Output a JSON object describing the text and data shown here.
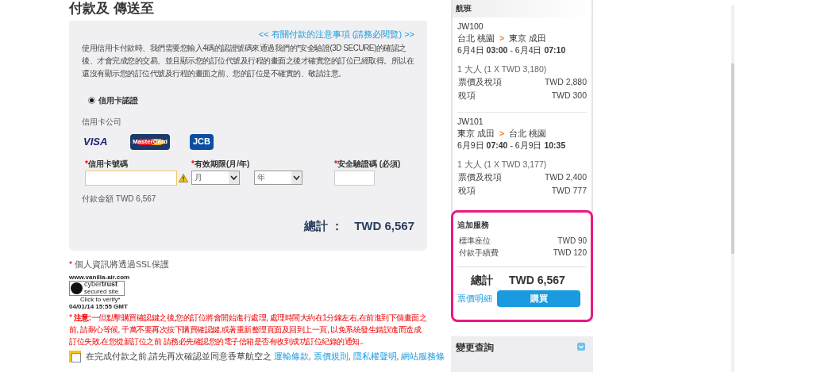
{
  "page_title": "付款及 傳送至",
  "payment": {
    "notice_link": "<< 有關付款的注意事項 (請務必閱覽) >>",
    "intro": "使用信用卡付款時、我們需要您輸入4碼的認證號碼來通過我們的*安全驗證(3D SECURE)的確認之後、才會完成您的交易、並且顯示您的訂位代號及行程的畫面之後才確實您的訂位已經取得。所以在還沒有顯示您的訂位代號及行程的畫面之前、您的訂位是不確實的、敬請注意。",
    "methods": [
      {
        "label": "信用卡認證",
        "selected": true
      }
    ],
    "card_company_label": "信用卡公司",
    "cards": [
      {
        "kind": "visa",
        "label": "VISA"
      },
      {
        "kind": "mastercard",
        "label": "MasterCard"
      },
      {
        "kind": "jcb",
        "label": "JCB"
      }
    ],
    "fields": [
      {
        "kind": "text",
        "mark": "*",
        "label": "信用卡號碼",
        "warning": true
      },
      {
        "kind": "expiry",
        "mark": "*",
        "label": "有效期限(月/年)",
        "selects": [
          "月",
          "年"
        ]
      },
      {
        "kind": "cvv",
        "mark": "*",
        "label": "安全驗證碼 (必須)"
      }
    ],
    "amount": "付款金額 TWD 6,567",
    "total_label": "總計 ：",
    "total_value": "TWD 6,567"
  },
  "ssl": {
    "mark": "*",
    "text": "個人資訊將透過SSL保護"
  },
  "seal": {
    "site": "www.vanilla-air.com",
    "brand_light": "cyber",
    "brand_bold": "trust",
    "sub": "secured site",
    "verify": "Click to verify*",
    "date": "04/01/14 15:55 GMT"
  },
  "caution": "* **注意:**一但點擊購買確認鍵之後,您的訂位將會開始進行處理, 處理時間大約在1分鐘左右,在前進到下個畫面之前, 請耐心等候, 千萬不要再次按下購買確認鍵,或著重新整理頁面及回到上一頁, 以免系統發生錯誤進而造成訂位失敗.在您從新訂位之前 請務必先確認您的電子信箱是否有收到成功訂位紀錄的通知..",
  "agree": {
    "checked": false,
    "text": "在完成付款之前,請先再次確認並同意香草航空之",
    "links": [
      "運輸條款",
      "票價規則",
      "隱私權聲明",
      "網站服務條"
    ],
    "separators": [
      ",",
      ",",
      ","
    ]
  },
  "sidebar": {
    "header": "航班",
    "flights": [
      {
        "number": "JW100",
        "from": "台北 桃園",
        "arrow": ">",
        "to": "東京 成田",
        "time": "6月4日 **03:00** - 6月4日 **07:10**",
        "pax": "1 大人 (1 X TWD 3,180)",
        "rows": [
          {
            "label": "票價及稅項",
            "value": "TWD 2,880"
          },
          {
            "label": "稅項",
            "value": "TWD 300"
          }
        ]
      },
      {
        "number": "JW101",
        "from": "東京 成田",
        "arrow": ">",
        "to": "台北 桃園",
        "time": "6月9日 **07:40** - 6月9日 **10:35**",
        "pax": "1 大人 (1 X TWD 3,177)",
        "rows": [
          {
            "label": "票價及稅項",
            "value": "TWD 2,400"
          },
          {
            "label": "稅項",
            "value": "TWD 777"
          }
        ]
      }
    ],
    "extras": {
      "header": "追加服務",
      "rows": [
        {
          "label": "標準座位",
          "value": "TWD 90"
        },
        {
          "label": "付款手續費",
          "value": "TWD 120"
        }
      ],
      "total_label": "總計",
      "total_value": "TWD 6,567",
      "details_link": "票價明細",
      "buy_button": "購買"
    },
    "change": {
      "title": "變更查詢",
      "expanded": false
    }
  }
}
